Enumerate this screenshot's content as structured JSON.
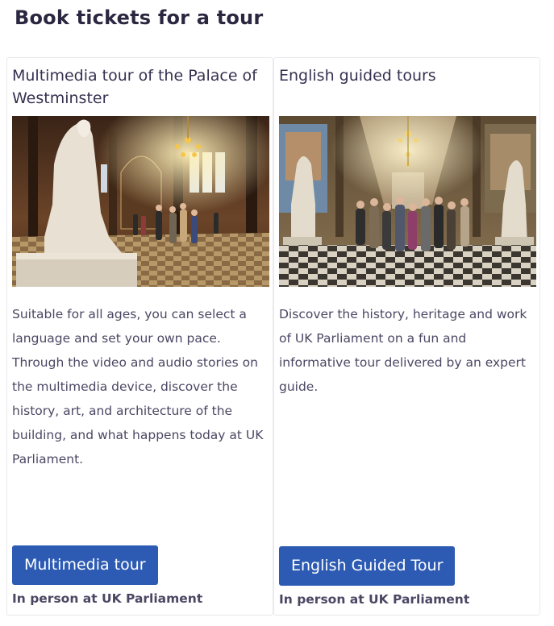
{
  "page": {
    "title": "Book tickets for a tour"
  },
  "cards": [
    {
      "title": "Multimedia tour of the Palace of Westminster",
      "image_subject": "gothic-hall-with-statue-and-chandelier",
      "description": "Suitable for all ages, you can select a language and set your own pace. Through the video and audio stories on the multimedia device, discover the history, art, and architecture of the building, and what happens today at UK Parliament.",
      "button_label": "Multimedia tour",
      "location": "In person at UK Parliament"
    },
    {
      "title": "English guided tours",
      "image_subject": "tour-group-in-painted-gallery",
      "description": "Discover the history, heritage and work of UK Parliament on a fun and informative tour delivered by an expert guide.",
      "button_label": "English Guided Tour",
      "location": "In person at UK Parliament"
    }
  ],
  "colors": {
    "button": "#2d5bb3",
    "title": "#2b2740",
    "text": "#4b4763",
    "border": "#e9e9ee"
  }
}
